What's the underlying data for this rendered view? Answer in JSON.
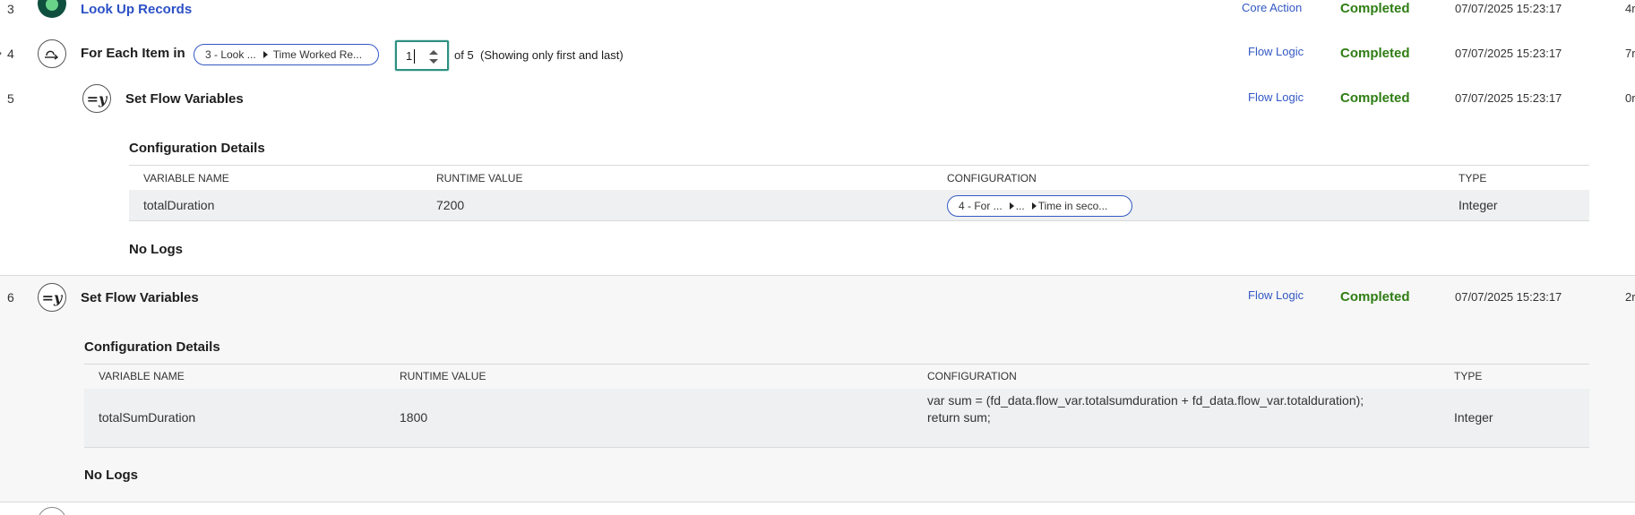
{
  "steps": [
    {
      "num": "3",
      "title": "Look Up Records",
      "type": "Core Action",
      "status": "Completed",
      "timestamp": "07/07/2025 15:23:17",
      "duration": "4r"
    },
    {
      "num": "4",
      "title": "For Each Item in",
      "pill_part1": "3 - Look ...",
      "pill_part2": "Time Worked Re...",
      "iteration_value": "1",
      "of_text": "of 5",
      "note": "(Showing only first and last)",
      "type": "Flow Logic",
      "status": "Completed",
      "timestamp": "07/07/2025 15:23:17",
      "duration": "7r"
    },
    {
      "num": "5",
      "title": "Set Flow Variables",
      "icon_text": "=y",
      "type": "Flow Logic",
      "status": "Completed",
      "timestamp": "07/07/2025 15:23:17",
      "duration": "0r",
      "config_heading": "Configuration Details",
      "columns": [
        "VARIABLE NAME",
        "RUNTIME VALUE",
        "CONFIGURATION",
        "TYPE"
      ],
      "row": {
        "name": "totalDuration",
        "value": "7200",
        "config_pill": [
          "4 - For ...",
          "...",
          "Time in seco..."
        ],
        "type": "Integer"
      },
      "logs": "No Logs"
    },
    {
      "num": "6",
      "title": "Set Flow Variables",
      "icon_text": "=y",
      "type": "Flow Logic",
      "status": "Completed",
      "timestamp": "07/07/2025 15:23:17",
      "duration": "2r",
      "config_heading": "Configuration Details",
      "columns": [
        "VARIABLE NAME",
        "RUNTIME VALUE",
        "CONFIGURATION",
        "TYPE"
      ],
      "row": {
        "name": "totalSumDuration",
        "value": "1800",
        "config_line1": "var sum = (fd_data.flow_var.totalsumduration + fd_data.flow_var.totalduration);",
        "config_line2": "return sum;",
        "type": "Integer"
      },
      "logs": "No Logs"
    }
  ],
  "colors": {
    "link": "#2b50c6",
    "status_completed": "#2f7d14",
    "stepper_focus": "#2d8f82",
    "row_bg": "#eef0f1"
  }
}
